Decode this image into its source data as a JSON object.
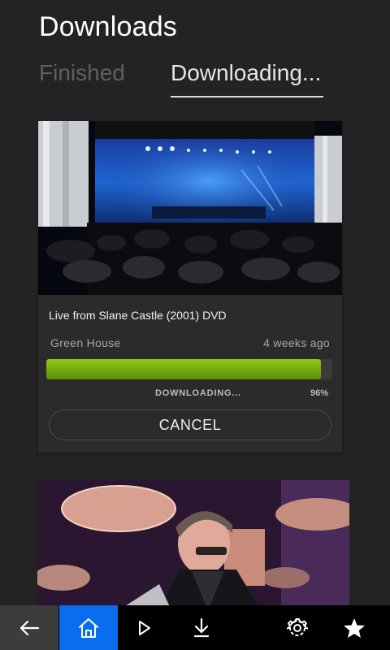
{
  "header": {
    "title": "Downloads"
  },
  "tabs": [
    {
      "label": "Finished",
      "selected": false
    },
    {
      "label": "Downloading...",
      "selected": true
    }
  ],
  "downloads": [
    {
      "title": "Live from Slane Castle (2001) DVD",
      "source": "Green House",
      "time_ago": "4 weeks ago",
      "status": "DOWNLOADING...",
      "percent_label": "96%",
      "progress": 0.96,
      "cancel_label": "CANCEL"
    }
  ],
  "navbar": {
    "items": [
      {
        "icon": "back-arrow-icon"
      },
      {
        "icon": "home-icon",
        "active": true
      },
      {
        "icon": "play-icon"
      },
      {
        "icon": "download-icon"
      },
      {
        "icon": "gear-icon"
      },
      {
        "icon": "star-icon"
      }
    ]
  },
  "colors": {
    "background": "#232323",
    "card": "#2b2b2b",
    "progress": "#7cb814",
    "nav_active": "#0a6df0"
  }
}
